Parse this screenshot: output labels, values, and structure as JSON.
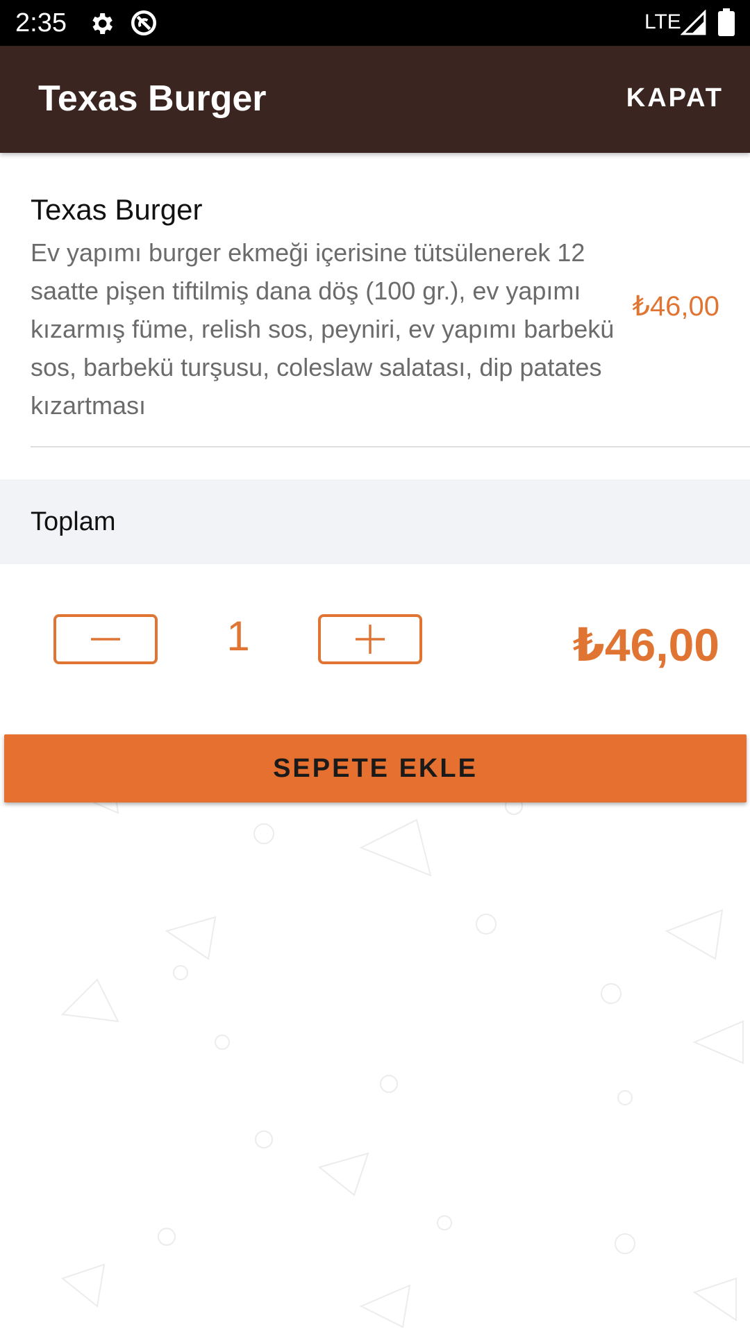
{
  "status_bar": {
    "time": "2:35",
    "network": "LTE",
    "icons": [
      "settings-icon",
      "sync-icon",
      "signal-icon",
      "battery-icon"
    ]
  },
  "app_bar": {
    "title": "Texas Burger",
    "close_label": "KAPAT"
  },
  "product": {
    "name": "Texas Burger",
    "description": "Ev yapımı burger ekmeği içerisine tütsülenerek 12 saatte pişen tiftilmiş dana döş (100 gr.), ev yapımı kızarmış füme, relish sos, peyniri, ev yapımı barbekü sos, barbekü turşusu, coleslaw salatası, dip patates kızartması",
    "price": "₺46,00"
  },
  "total": {
    "label": "Toplam",
    "quantity": "1",
    "amount": "₺46,00"
  },
  "actions": {
    "add_to_cart_label": "SEPETE EKLE"
  },
  "colors": {
    "app_bar": "#3a2520",
    "accent": "#e07533",
    "button": "#e5702f",
    "section_bg": "#f2f3f6"
  }
}
